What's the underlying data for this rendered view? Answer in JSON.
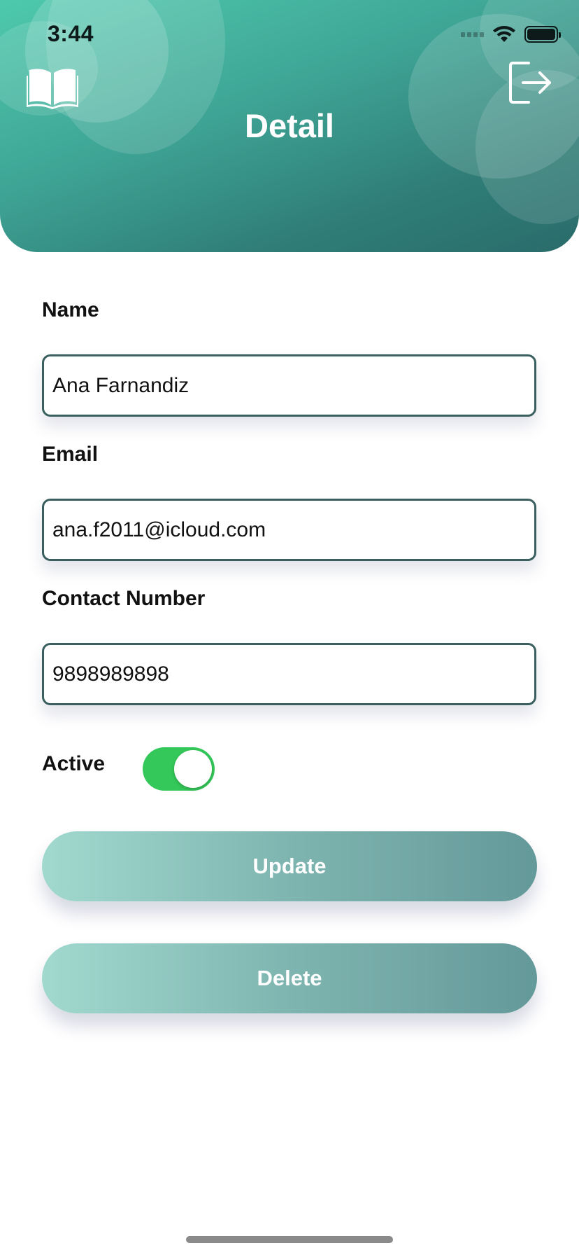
{
  "status_bar": {
    "time": "3:44"
  },
  "header": {
    "title": "Detail"
  },
  "form": {
    "name_label": "Name",
    "name_value": "Ana Farnandiz",
    "email_label": "Email",
    "email_value": "ana.f2011@icloud.com",
    "contact_label": "Contact Number",
    "contact_value": "9898989898",
    "active_label": "Active",
    "active_on": true
  },
  "actions": {
    "update_label": "Update",
    "delete_label": "Delete"
  },
  "colors": {
    "header_start": "#4ec9ad",
    "header_end": "#2a6c6b",
    "field_border": "#3a5f5f",
    "toggle_on": "#34c759",
    "button_start": "#a1d9cf",
    "button_end": "#64999a"
  },
  "icons": {
    "left": "book-open-icon",
    "right": "logout-icon"
  }
}
